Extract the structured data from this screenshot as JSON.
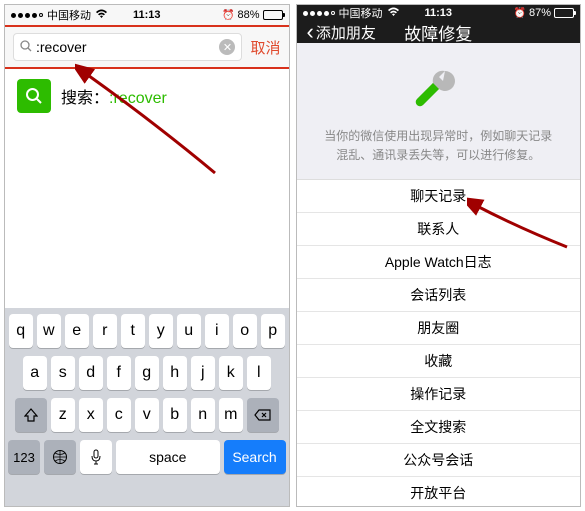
{
  "left": {
    "status": {
      "carrier": "中国移动",
      "time": "11:13",
      "battery_pct": "88%",
      "alarm": "⏰"
    },
    "search": {
      "prefix_icon": "search",
      "value": ":recover",
      "cancel": "取消"
    },
    "result": {
      "label_prefix": "搜索：",
      "keyword": ":recover"
    },
    "keyboard": {
      "row1": [
        "q",
        "w",
        "e",
        "r",
        "t",
        "y",
        "u",
        "i",
        "o",
        "p"
      ],
      "row2": [
        "a",
        "s",
        "d",
        "f",
        "g",
        "h",
        "j",
        "k",
        "l"
      ],
      "row3": [
        "z",
        "x",
        "c",
        "v",
        "b",
        "n",
        "m"
      ],
      "123": "123",
      "space": "space",
      "search": "Search"
    }
  },
  "right": {
    "status": {
      "carrier": "中国移动",
      "time": "11:13",
      "battery_pct": "87%",
      "alarm": "⏰"
    },
    "nav": {
      "back": "添加朋友",
      "title": "故障修复"
    },
    "tagline_l1": "当你的微信使用出现异常时，例如聊天记录",
    "tagline_l2": "混乱、通讯录丢失等，可以进行修复。",
    "items": [
      "聊天记录",
      "联系人",
      "Apple Watch日志",
      "会话列表",
      "朋友圈",
      "收藏",
      "操作记录",
      "全文搜索",
      "公众号会话",
      "开放平台"
    ]
  }
}
